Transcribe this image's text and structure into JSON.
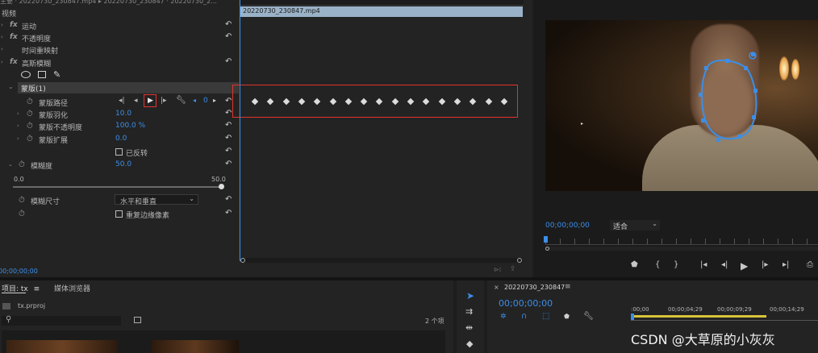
{
  "effects_panel": {
    "top_clip_tabs": "主要 · 20220730_230847.mp4 ▸ 20220730_230847 · 20220730_2...",
    "video_header": "视频",
    "rows": {
      "motion": "运动",
      "opacity": "不透明度",
      "time_remap": "时间重映射",
      "gaussian_blur": "高斯模糊",
      "mask": "蒙版(1)",
      "mask_path": "蒙版路径",
      "mask_feather": "蒙版羽化",
      "mask_opacity": "蒙版不透明度",
      "mask_expansion": "蒙版扩展",
      "inverted": "已反转",
      "blurriness": "模糊度",
      "blur_dimensions": "模糊尺寸",
      "repeat_edge": "重复边缘像素"
    },
    "values": {
      "mask_feather": "10.0",
      "mask_opacity": "100.0 %",
      "mask_expansion": "0.0",
      "blurriness": "50.0",
      "slider_min": "0.0",
      "slider_max": "50.0",
      "blur_dimensions": "水平和垂直",
      "keyframe_count": "0"
    },
    "timeline_clip": "20220730_230847.mp4",
    "timecode": "00;00;00;00",
    "slider_value_fraction": 1.0
  },
  "program_monitor": {
    "timecode": "00;00;00;00",
    "fit": "适合"
  },
  "project_panel": {
    "tab_project": "项目: tx",
    "tab_media_browser": "媒体浏览器",
    "file": "tx.prproj",
    "item_count": "2 个项"
  },
  "sequence_panel": {
    "name": "20220730_230847",
    "timecode": "00;00;00;00",
    "ruler": [
      ":00;00",
      "00;00;04;29",
      "00;00;09;29",
      "00;00;14;29"
    ]
  },
  "watermark": "CSDN @大草原的小灰灰"
}
